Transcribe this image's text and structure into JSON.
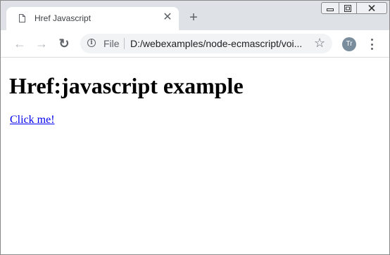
{
  "tab": {
    "title": "Href Javascript",
    "close_glyph": "✕"
  },
  "new_tab_glyph": "+",
  "toolbar": {
    "back_glyph": "←",
    "forward_glyph": "→",
    "reload_glyph": "↻",
    "info_glyph": "i",
    "scheme_label": "File",
    "url": "D:/webexamples/node-ecmascript/voi...",
    "star_glyph": "☆",
    "avatar_initials": "Tr"
  },
  "page": {
    "heading": "Href:javascript example",
    "link_text": "Click me!"
  },
  "colors": {
    "link": "#0000ee",
    "tab_strip": "#dee1e6",
    "omnibox": "#f1f3f4"
  }
}
